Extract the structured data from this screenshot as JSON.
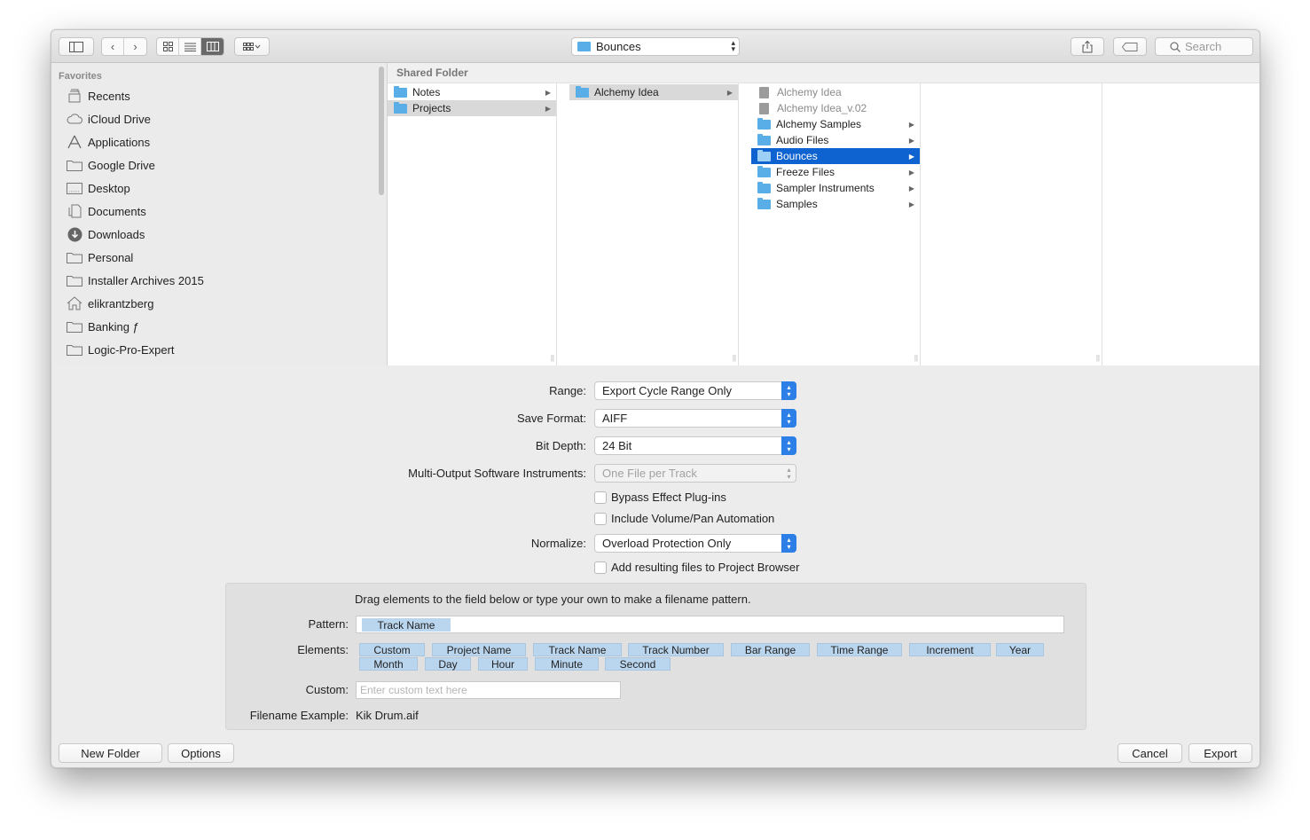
{
  "toolbar": {
    "location": "Bounces",
    "search_placeholder": "Search"
  },
  "sidebar": {
    "section_title": "Favorites",
    "items": [
      {
        "label": "Recents",
        "icon": "clock-icon"
      },
      {
        "label": "iCloud Drive",
        "icon": "cloud-icon"
      },
      {
        "label": "Applications",
        "icon": "applications-icon"
      },
      {
        "label": "Google Drive",
        "icon": "folder-icon"
      },
      {
        "label": "Desktop",
        "icon": "desktop-icon"
      },
      {
        "label": "Documents",
        "icon": "documents-icon"
      },
      {
        "label": "Downloads",
        "icon": "download-icon"
      },
      {
        "label": "Personal",
        "icon": "folder-icon"
      },
      {
        "label": "Installer Archives 2015",
        "icon": "folder-icon"
      },
      {
        "label": "elikrantzberg",
        "icon": "home-icon"
      },
      {
        "label": "Banking ƒ",
        "icon": "folder-icon"
      },
      {
        "label": "Logic-Pro-Expert",
        "icon": "folder-icon"
      }
    ]
  },
  "browser": {
    "path_header": "Shared Folder",
    "col1": [
      "Notes",
      "Projects"
    ],
    "col2": [
      "Alchemy Idea"
    ],
    "col3": [
      "Alchemy Idea",
      "Alchemy Idea_v.02",
      "Alchemy Samples",
      "Audio Files",
      "Bounces",
      "Freeze Files",
      "Sampler Instruments",
      "Samples"
    ]
  },
  "options": {
    "range_label": "Range:",
    "range_value": "Export Cycle Range Only",
    "format_label": "Save Format:",
    "format_value": "AIFF",
    "depth_label": "Bit Depth:",
    "depth_value": "24 Bit",
    "multi_label": "Multi-Output Software Instruments:",
    "multi_value": "One File per Track",
    "bypass_label": "Bypass Effect Plug-ins",
    "volpan_label": "Include Volume/Pan Automation",
    "normalize_label": "Normalize:",
    "normalize_value": "Overload Protection Only",
    "add_label": "Add resulting files to Project Browser"
  },
  "pattern": {
    "instructions": "Drag elements to the field below or type your own to make a filename pattern.",
    "pattern_label": "Pattern:",
    "pattern_token": "Track Name",
    "elements_label": "Elements:",
    "elements": [
      "Custom",
      "Project Name",
      "Track Name",
      "Track Number",
      "Bar Range",
      "Time Range",
      "Increment",
      "Year",
      "Month",
      "Day",
      "Hour",
      "Minute",
      "Second"
    ],
    "custom_label": "Custom:",
    "custom_placeholder": "Enter custom text here",
    "example_label": "Filename Example:",
    "example_value": "Kik Drum.aif"
  },
  "buttons": {
    "new_folder": "New Folder",
    "options": "Options",
    "cancel": "Cancel",
    "export": "Export"
  },
  "colors": {
    "selection": "#0f63d1",
    "folder": "#5aaee8",
    "token": "#bad5ee"
  }
}
